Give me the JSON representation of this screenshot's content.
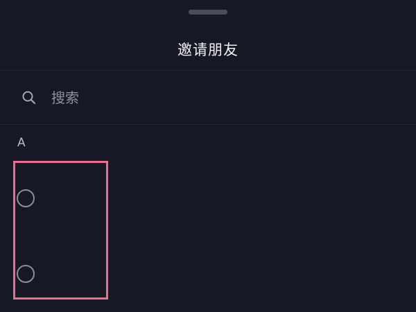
{
  "header": {
    "title": "邀请朋友"
  },
  "search": {
    "placeholder": "搜索",
    "value": "",
    "icon": "search-icon"
  },
  "contacts": {
    "section_letter": "A",
    "items": [
      {
        "selected": false,
        "icon": "radio-unchecked-icon"
      },
      {
        "selected": false,
        "icon": "radio-unchecked-icon"
      }
    ]
  },
  "colors": {
    "background": "#161824",
    "highlight": "#ee6d8f",
    "text_primary": "#f2f2f5",
    "text_muted": "#8e909c"
  }
}
